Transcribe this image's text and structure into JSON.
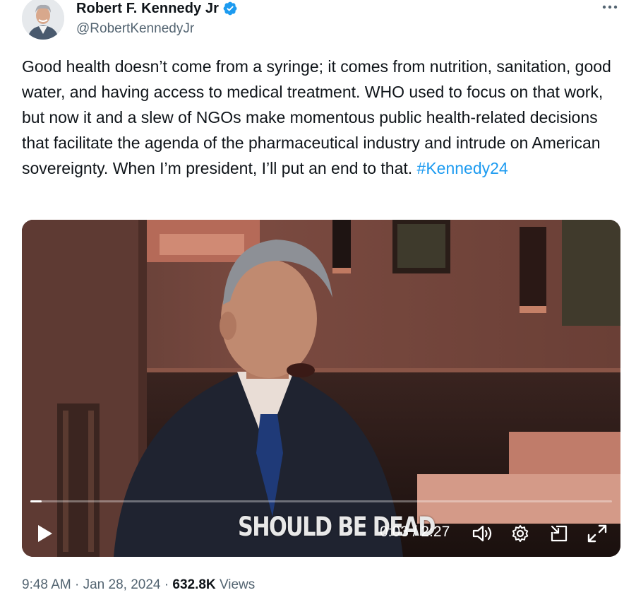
{
  "author": {
    "display_name": "Robert F. Kennedy Jr",
    "handle": "@RobertKennedyJr",
    "verified_badge_color": "#1d9bf0",
    "more_icon": "more-horizontal-icon"
  },
  "tweet": {
    "text": "Good health doesn’t come from a syringe; it comes from nutrition, sanitation, good water, and having access to medical treatment. WHO used to focus on that work, but now it and a slew of NGOs make momentous public health-related decisions that facilitate the agenda of the pharmaceutical industry and intrude on American sovereignty. When I’m president, I’ll put an end to that.",
    "hashtag": "#Kennedy24",
    "hashtag_color": "#1d9bf0"
  },
  "video": {
    "caption": "SHOULD BE DEAD",
    "time_display": "0:03 / 2:27",
    "progress_fraction": 0.02,
    "controls": {
      "play_icon": "play-icon",
      "volume_icon": "volume-icon",
      "settings_icon": "gear-icon",
      "minimize_icon": "minimize-player-icon",
      "fullscreen_icon": "fullscreen-icon"
    }
  },
  "footer": {
    "time": "9:48 AM",
    "separator": "·",
    "date": "Jan 28, 2024",
    "views_count": "632.8K",
    "views_label": "Views"
  }
}
